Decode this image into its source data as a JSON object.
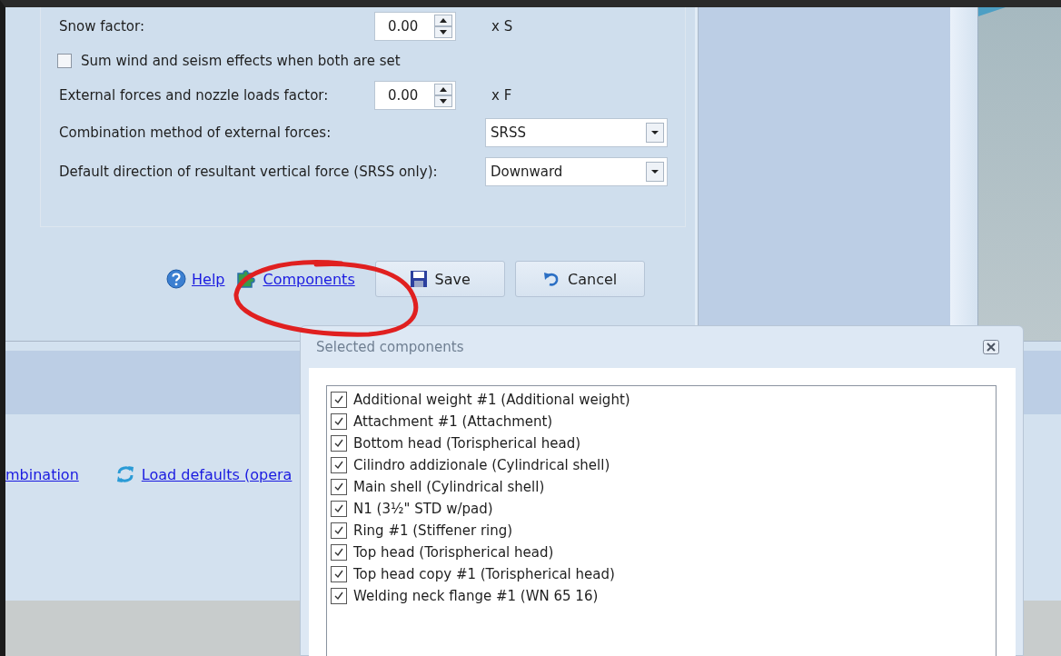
{
  "factors": [
    {
      "kind": "spin",
      "label": "Snow factor:",
      "value": "0.00",
      "unit": "x S"
    },
    {
      "kind": "checkbox",
      "label": "Sum wind and seism effects when both are set",
      "checked": false
    },
    {
      "kind": "spin",
      "label": "External forces and nozzle loads factor:",
      "value": "0.00",
      "unit": "x F"
    },
    {
      "kind": "combo",
      "label": "Combination method of external forces:",
      "value": "SRSS"
    },
    {
      "kind": "combo",
      "label": "Default direction of resultant vertical force (SRSS only):",
      "value": "Downward"
    }
  ],
  "actions": {
    "help": "Help",
    "components": "Components",
    "save": "Save",
    "cancel": "Cancel"
  },
  "lower_links": [
    {
      "kind": "plain",
      "label": "mbination"
    },
    {
      "kind": "refresh",
      "label": "Load defaults (opera"
    }
  ],
  "components_popup": {
    "title": "Selected components",
    "items": [
      {
        "label": "Additional weight #1 (Additional weight)",
        "checked": true
      },
      {
        "label": "Attachment #1 (Attachment)",
        "checked": true
      },
      {
        "label": "Bottom head (Torispherical head)",
        "checked": true
      },
      {
        "label": "Cilindro addizionale (Cylindrical shell)",
        "checked": true
      },
      {
        "label": "Main shell (Cylindrical shell)",
        "checked": true
      },
      {
        "label": "N1 (3½\" STD w/pad)",
        "checked": true
      },
      {
        "label": "Ring #1 (Stiffener ring)",
        "checked": true
      },
      {
        "label": "Top head (Torispherical head)",
        "checked": true
      },
      {
        "label": "Top head copy #1 (Torispherical head)",
        "checked": true
      },
      {
        "label": "Welding neck flange #1 (WN 65 16)",
        "checked": true
      }
    ]
  }
}
